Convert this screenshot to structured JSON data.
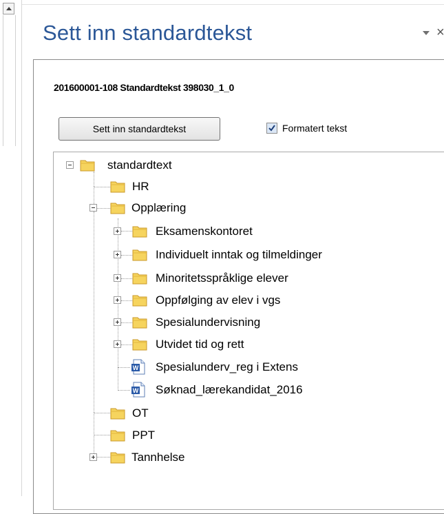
{
  "pane": {
    "title": "Sett inn standardtekst",
    "close_glyph": "×"
  },
  "document": {
    "id_label": "201600001-108 Standardtekst 398030_1_0"
  },
  "actions": {
    "insert_button": "Sett inn standardtekst",
    "formatted_text_label": "Formatert tekst",
    "formatted_text_checked": true
  },
  "tree": {
    "root": "standardtext",
    "hr": "HR",
    "opplaering": "Opplæring",
    "eksamen": "Eksamenskontoret",
    "individuelt": "Individuelt inntak og tilmeldinger",
    "minoritet": "Minoritetsspråklige elever",
    "oppfolging": "Oppfølging av elev i vgs",
    "spesial": "Spesialundervisning",
    "utvidet": "Utvidet tid og rett",
    "doc_spesial": "Spesialunderv_reg i Extens",
    "doc_soknad": "Søknad_lærekandidat_2016",
    "ot": "OT",
    "ppt": "PPT",
    "tannhelse": "Tannhelse"
  },
  "icons": {
    "folder": "folder-icon",
    "document": "word-document-icon",
    "expand": "plus-expander-icon",
    "collapse": "minus-expander-icon"
  },
  "colors": {
    "title": "#2b5797",
    "folder_fill": "#f6d45e",
    "folder_edge": "#c9992a"
  }
}
